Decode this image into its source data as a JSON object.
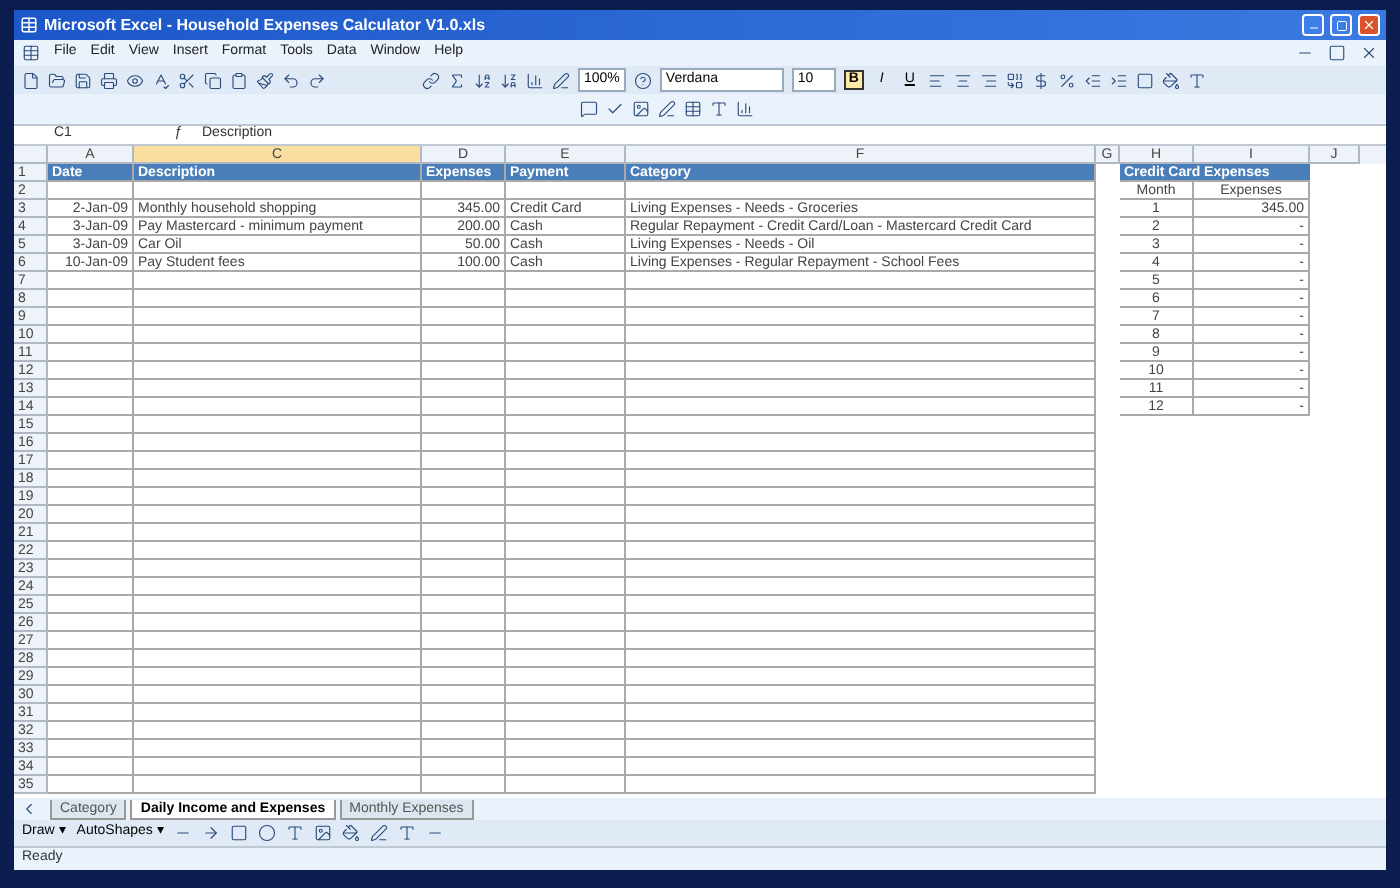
{
  "window": {
    "title": "Microsoft Excel - Household Expenses Calculator V1.0.xls"
  },
  "menu": [
    "File",
    "Edit",
    "View",
    "Insert",
    "Format",
    "Tools",
    "Data",
    "Window",
    "Help"
  ],
  "toolbar": {
    "zoom": "100%",
    "font": "Verdana",
    "font_size": "10"
  },
  "format_buttons": [
    {
      "label": "B",
      "selected": true
    },
    {
      "label": "I",
      "selected": false
    },
    {
      "label": "U",
      "selected": false
    }
  ],
  "formula_bar": {
    "cell": "C1",
    "symbol": "ƒ",
    "content": "Description"
  },
  "columns": [
    {
      "label": "A",
      "selected": false
    },
    {
      "label": "C",
      "selected": true
    },
    {
      "label": "D",
      "selected": false
    },
    {
      "label": "E",
      "selected": false
    },
    {
      "label": "F",
      "selected": false
    },
    {
      "label": "G",
      "selected": false
    },
    {
      "label": "H",
      "selected": false
    },
    {
      "label": "I",
      "selected": false
    },
    {
      "label": "J",
      "selected": false
    }
  ],
  "row_numbers": [
    "1",
    "2",
    "3",
    "4",
    "5",
    "6",
    "7",
    "8",
    "9",
    "10",
    "11",
    "12",
    "13",
    "14",
    "15",
    "16",
    "17",
    "18",
    "19",
    "20",
    "21",
    "22",
    "23",
    "24",
    "25",
    "26",
    "27",
    "28",
    "29",
    "30",
    "31",
    "32",
    "33",
    "34",
    "35"
  ],
  "main_table": {
    "header": [
      "Date",
      "Description",
      "Expenses",
      "Payment",
      "Category"
    ],
    "rows": [
      [
        "2-Jan-09",
        "Monthly household shopping",
        "345.00",
        "Credit Card",
        "Living Expenses - Needs - Groceries"
      ],
      [
        "3-Jan-09",
        "Pay Mastercard - minimum payment",
        "200.00",
        "Cash",
        "Regular Repayment - Credit Card/Loan - Mastercard Credit Card"
      ],
      [
        "3-Jan-09",
        "Car Oil",
        "50.00",
        "Cash",
        "Living Expenses - Needs - Oil"
      ],
      [
        "10-Jan-09",
        "Pay Student fees",
        "100.00",
        "Cash",
        "Living Expenses - Regular Repayment - School Fees"
      ]
    ]
  },
  "credit_card": {
    "title": "Credit Card Expenses",
    "columns": [
      "Month",
      "Expenses"
    ],
    "rows": [
      [
        "1",
        "345.00"
      ],
      [
        "2",
        "-"
      ],
      [
        "3",
        "-"
      ],
      [
        "4",
        "-"
      ],
      [
        "5",
        "-"
      ],
      [
        "6",
        "-"
      ],
      [
        "7",
        "-"
      ],
      [
        "8",
        "-"
      ],
      [
        "9",
        "-"
      ],
      [
        "10",
        "-"
      ],
      [
        "11",
        "-"
      ],
      [
        "12",
        "-"
      ]
    ]
  },
  "sheet_tabs": [
    {
      "label": "Category",
      "selected": false
    },
    {
      "label": "Daily Income and Expenses",
      "selected": true
    },
    {
      "label": "Monthly Expenses",
      "selected": false
    }
  ],
  "drawing_toolbar": [
    "Draw ▾",
    "AutoShapes ▾"
  ],
  "status_bar": "Ready"
}
